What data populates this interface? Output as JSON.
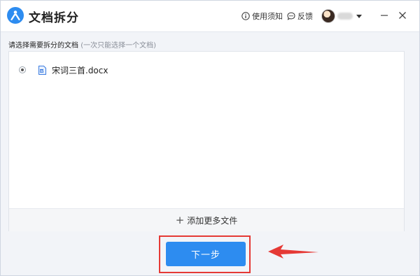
{
  "titlebar": {
    "app_title": "文档拆分",
    "help_label": "使用须知",
    "feedback_label": "反馈"
  },
  "instruction": {
    "text": "请选择需要拆分的文档",
    "hint": "(一次只能选择一个文档)"
  },
  "files": [
    {
      "name": "宋词三首.docx",
      "selected": true
    }
  ],
  "add_more_label": "添加更多文件",
  "next_button_label": "下一步",
  "colors": {
    "accent": "#2d8cf0",
    "annotation": "#e53935"
  }
}
